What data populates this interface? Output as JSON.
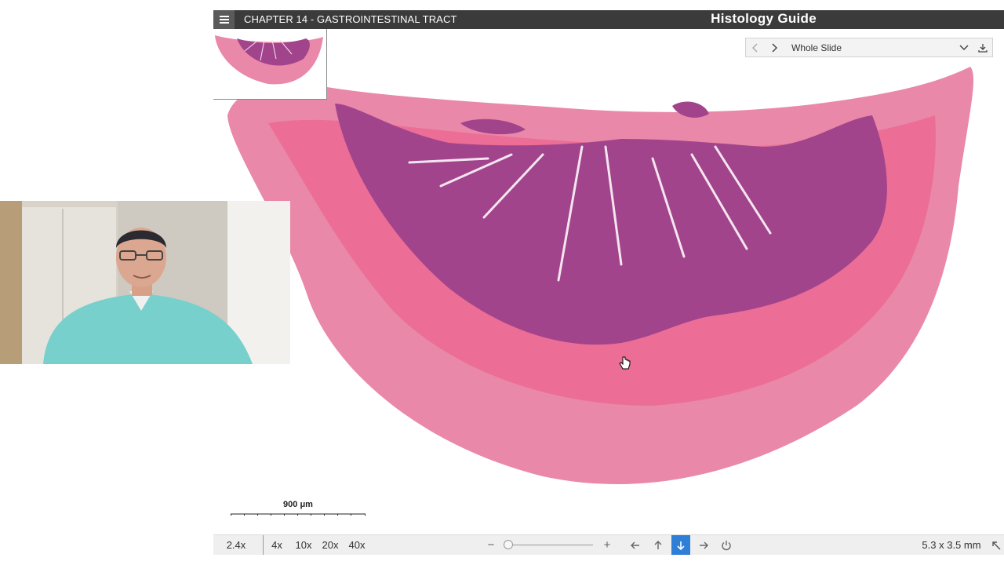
{
  "header": {
    "chapter": "CHAPTER 14 - GASTROINTESTINAL TRACT",
    "brand": "Histology Guide",
    "menu_icon": "hamburger-menu-icon"
  },
  "navigator": {
    "title": "Whole Slide",
    "icons": [
      "chevron-left-icon",
      "chevron-right-icon",
      "chevron-down-icon",
      "download-icon"
    ]
  },
  "scale_bar": {
    "label": "900 μm"
  },
  "toolbar": {
    "current_zoom": "2.4x",
    "zoom_presets": [
      "4x",
      "10x",
      "20x",
      "40x"
    ],
    "zoom_out": "−",
    "zoom_in": "+",
    "slide_size": "5.3 x 3.5 mm",
    "active_direction": "down",
    "icons": [
      "arrow-left-icon",
      "arrow-up-icon",
      "arrow-down-icon",
      "arrow-right-icon",
      "power-icon",
      "expand-corner-icon"
    ]
  },
  "colors": {
    "header_bg": "#3b3b3b",
    "accent": "#2f7fd8",
    "tissue_pink": "#e8799f",
    "mucosa_purple": "#9a3f86"
  }
}
